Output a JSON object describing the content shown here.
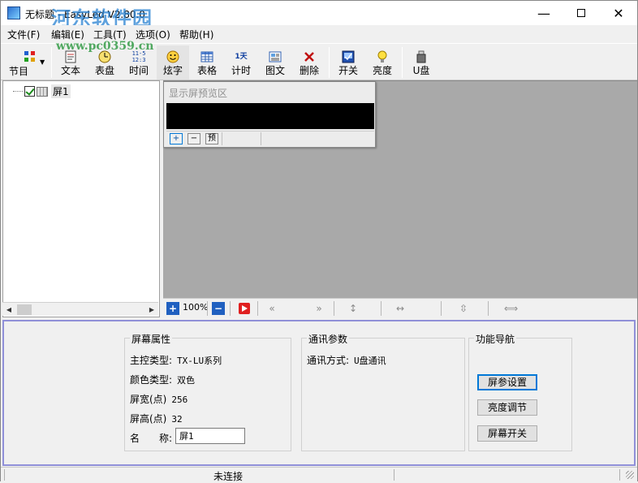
{
  "window": {
    "title": "无标题 - EasyLed V2.80.0"
  },
  "watermark": {
    "big": "河东软件园",
    "small": "www.pc0359.cn"
  },
  "menu": [
    "文件(F)",
    "编辑(E)",
    "工具(T)",
    "选项(O)",
    "帮助(H)"
  ],
  "toolbar": {
    "program": "节目",
    "text": "文本",
    "dial": "表盘",
    "time": "时间",
    "fancy": "炫字",
    "table": "表格",
    "timer": "计时",
    "image_text": "图文",
    "delete": "删除",
    "switch": "开关",
    "brightness": "亮度",
    "usb": "U盘",
    "time_icon_text": "11-5 12:3",
    "timer_icon_text": "1天"
  },
  "tree": {
    "screen1": "屏1"
  },
  "preview": {
    "title": "显示屏预览区",
    "plus": "+",
    "minus": "−",
    "preview_btn": "预"
  },
  "preview_toolbar": {
    "zoom": "100%"
  },
  "screen_props": {
    "title": "屏幕属性",
    "controller_label": "主控类型:",
    "controller_value": "TX-LU系列",
    "color_label": "颜色类型:",
    "color_value": "双色",
    "width_label": "屏宽(点)",
    "width_value": "256",
    "height_label": "屏高(点)",
    "height_value": "32",
    "name_label": "名　　称:",
    "name_value": "屏1"
  },
  "comm": {
    "title": "通讯参数",
    "mode_label": "通讯方式:",
    "mode_value": "U盘通讯"
  },
  "nav": {
    "title": "功能导航",
    "screen_settings": "屏参设置",
    "brightness_adjust": "亮度调节",
    "screen_switch": "屏幕开关"
  },
  "status": {
    "connection": "未连接"
  },
  "colors": {
    "accent": "#0078d7",
    "preview_bg": "#a9a9a9",
    "prop_border": "#9090d8"
  }
}
